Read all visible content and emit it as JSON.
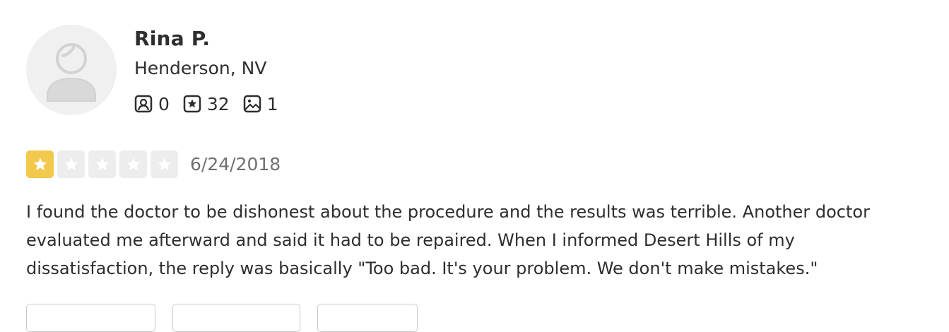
{
  "user": {
    "name": "Rina P.",
    "location": "Henderson, NV",
    "stats": {
      "friends": "0",
      "reviews": "32",
      "photos": "1"
    }
  },
  "review": {
    "rating": 1,
    "rating_max": 5,
    "date": "6/24/2018",
    "text_lines": [
      "I found the doctor to be dishonest about the procedure and the results was terrible. Another doctor",
      "evaluated me afterward and said it had to be repaired. When I informed Desert Hills of my",
      "dissatisfaction, the reply was basically \"Too bad. It's your problem. We don't make mistakes.\""
    ]
  },
  "colors": {
    "star_filled": "#f2c94c",
    "star_empty": "#ededed",
    "text": "#2d2e2f",
    "muted": "#6e7072"
  }
}
